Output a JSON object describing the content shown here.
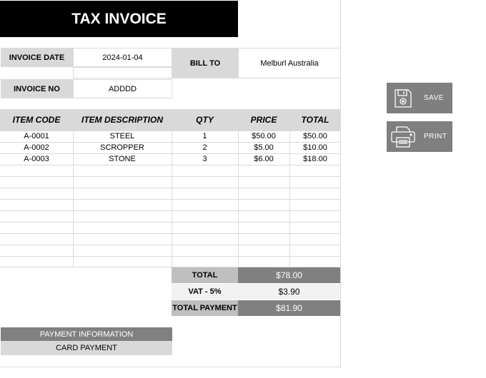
{
  "invoice": {
    "title": "TAX INVOICE",
    "date_label": "INVOICE DATE",
    "date_value": "2024-01-04",
    "bill_to_label": "BILL TO",
    "bill_to_value": "Melburl Australia",
    "no_label": "INVOICE NO",
    "no_value": "ADDDD"
  },
  "table": {
    "headers": [
      "ITEM CODE",
      "ITEM DESCRIPTION",
      "QTY",
      "PRICE",
      "TOTAL"
    ],
    "rows": [
      [
        "A-0001",
        "STEEL",
        "1",
        "$50.00",
        "$50.00"
      ],
      [
        "A-0002",
        "SCROPPER",
        "2",
        "$5.00",
        "$10.00"
      ],
      [
        "A-0003",
        "STONE",
        "3",
        "$6.00",
        "$18.00"
      ]
    ]
  },
  "totals": {
    "total_label": "TOTAL",
    "total_value": "$78.00",
    "vat_label": "VAT - 5%",
    "vat_value": "$3.90",
    "payment_label": "TOTAL PAYMENT",
    "payment_value": "$81.90"
  },
  "payment": {
    "info_label": "PAYMENT INFORMATION",
    "method": "CARD PAYMENT"
  },
  "actions": {
    "save_label": "SAVE",
    "save_icon": "floppy-disk-icon",
    "print_label": "PRINT",
    "print_icon": "printer-icon"
  },
  "colors": {
    "title_bg": "#000000",
    "label_bg": "#d9d9d9",
    "accent_gray": "#808080",
    "button_bg": "#7f7f7f"
  }
}
